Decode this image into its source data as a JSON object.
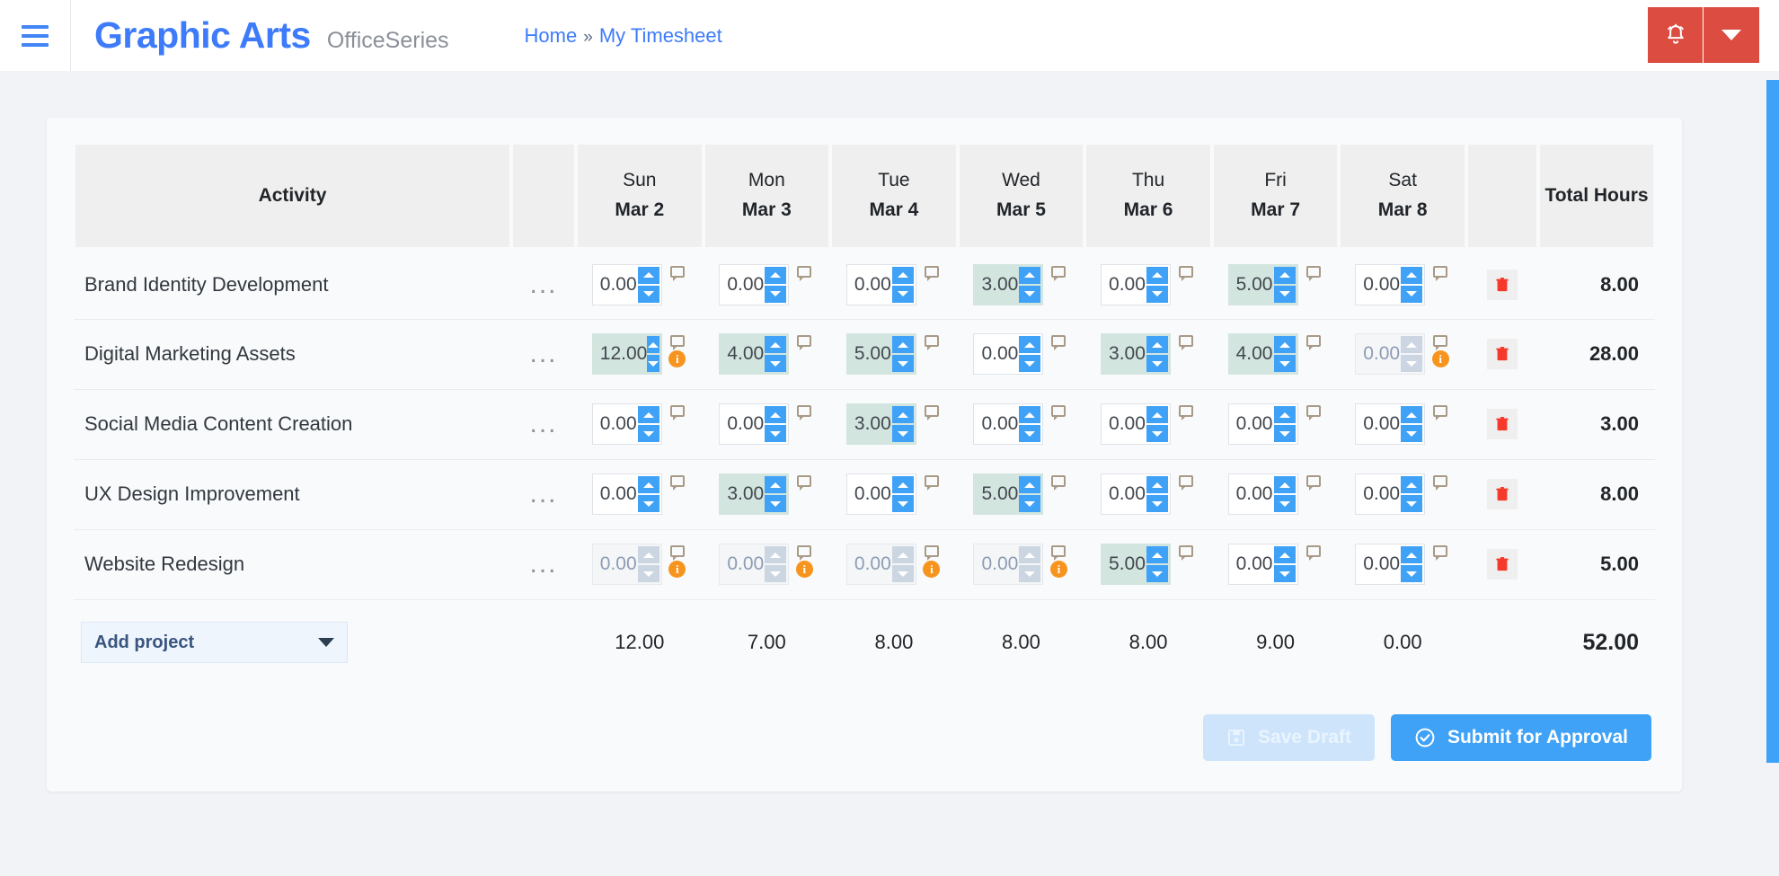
{
  "header": {
    "menu_icon": "hamburger-icon",
    "brand": "Graphic Arts",
    "brand_suffix": "OfficeSeries",
    "breadcrumb": {
      "home": "Home",
      "separator": "»",
      "current": "My Timesheet"
    },
    "notification_icon": "bell-icon",
    "notification_caret_icon": "chevron-down-icon",
    "notification_color": "#dc4c41",
    "brand_color": "#3d7bfb"
  },
  "table": {
    "columns": [
      {
        "label": "Activity"
      },
      {
        "dayname": "Sun",
        "daydate": "Mar 2"
      },
      {
        "dayname": "Mon",
        "daydate": "Mar 3"
      },
      {
        "dayname": "Tue",
        "daydate": "Mar 4"
      },
      {
        "dayname": "Wed",
        "daydate": "Mar 5"
      },
      {
        "dayname": "Thu",
        "daydate": "Mar 6"
      },
      {
        "dayname": "Fri",
        "daydate": "Mar 7"
      },
      {
        "dayname": "Sat",
        "daydate": "Mar 8"
      },
      {
        "label": "Total Hours"
      }
    ],
    "row_menu_icon": "ellipsis-icon",
    "comment_icon": "comment-icon",
    "info_icon": "info-icon",
    "delete_icon": "trash-icon",
    "rows": [
      {
        "activity": "Brand Identity Development",
        "cells": [
          {
            "value": "0.00",
            "filled": false,
            "disabled": false,
            "info": false
          },
          {
            "value": "0.00",
            "filled": false,
            "disabled": false,
            "info": false
          },
          {
            "value": "0.00",
            "filled": false,
            "disabled": false,
            "info": false
          },
          {
            "value": "3.00",
            "filled": true,
            "disabled": false,
            "info": false
          },
          {
            "value": "0.00",
            "filled": false,
            "disabled": false,
            "info": false
          },
          {
            "value": "5.00",
            "filled": true,
            "disabled": false,
            "info": false
          },
          {
            "value": "0.00",
            "filled": false,
            "disabled": false,
            "info": false
          }
        ],
        "total": "8.00"
      },
      {
        "activity": "Digital Marketing Assets",
        "cells": [
          {
            "value": "12.00",
            "filled": true,
            "disabled": false,
            "info": true
          },
          {
            "value": "4.00",
            "filled": true,
            "disabled": false,
            "info": false
          },
          {
            "value": "5.00",
            "filled": true,
            "disabled": false,
            "info": false
          },
          {
            "value": "0.00",
            "filled": false,
            "disabled": false,
            "info": false
          },
          {
            "value": "3.00",
            "filled": true,
            "disabled": false,
            "info": false
          },
          {
            "value": "4.00",
            "filled": true,
            "disabled": false,
            "info": false
          },
          {
            "value": "0.00",
            "filled": false,
            "disabled": true,
            "info": true
          }
        ],
        "total": "28.00"
      },
      {
        "activity": "Social Media Content Creation",
        "cells": [
          {
            "value": "0.00",
            "filled": false,
            "disabled": false,
            "info": false
          },
          {
            "value": "0.00",
            "filled": false,
            "disabled": false,
            "info": false
          },
          {
            "value": "3.00",
            "filled": true,
            "disabled": false,
            "info": false
          },
          {
            "value": "0.00",
            "filled": false,
            "disabled": false,
            "info": false
          },
          {
            "value": "0.00",
            "filled": false,
            "disabled": false,
            "info": false
          },
          {
            "value": "0.00",
            "filled": false,
            "disabled": false,
            "info": false
          },
          {
            "value": "0.00",
            "filled": false,
            "disabled": false,
            "info": false
          }
        ],
        "total": "3.00"
      },
      {
        "activity": "UX Design Improvement",
        "cells": [
          {
            "value": "0.00",
            "filled": false,
            "disabled": false,
            "info": false
          },
          {
            "value": "3.00",
            "filled": true,
            "disabled": false,
            "info": false
          },
          {
            "value": "0.00",
            "filled": false,
            "disabled": false,
            "info": false
          },
          {
            "value": "5.00",
            "filled": true,
            "disabled": false,
            "info": false
          },
          {
            "value": "0.00",
            "filled": false,
            "disabled": false,
            "info": false
          },
          {
            "value": "0.00",
            "filled": false,
            "disabled": false,
            "info": false
          },
          {
            "value": "0.00",
            "filled": false,
            "disabled": false,
            "info": false
          }
        ],
        "total": "8.00"
      },
      {
        "activity": "Website Redesign",
        "cells": [
          {
            "value": "0.00",
            "filled": false,
            "disabled": true,
            "info": true
          },
          {
            "value": "0.00",
            "filled": false,
            "disabled": true,
            "info": true
          },
          {
            "value": "0.00",
            "filled": false,
            "disabled": true,
            "info": true
          },
          {
            "value": "0.00",
            "filled": false,
            "disabled": true,
            "info": true
          },
          {
            "value": "5.00",
            "filled": true,
            "disabled": false,
            "info": false
          },
          {
            "value": "0.00",
            "filled": false,
            "disabled": false,
            "info": false
          },
          {
            "value": "0.00",
            "filled": false,
            "disabled": false,
            "info": false
          }
        ],
        "total": "5.00"
      }
    ],
    "footer": {
      "add_project_label": "Add project",
      "add_project_caret_icon": "chevron-down-icon",
      "day_totals": [
        "12.00",
        "7.00",
        "8.00",
        "8.00",
        "8.00",
        "9.00",
        "0.00"
      ],
      "grand_total": "52.00"
    }
  },
  "actions": {
    "save_draft": {
      "label": "Save Draft",
      "icon": "save-icon",
      "disabled": true
    },
    "submit": {
      "label": "Submit for Approval",
      "icon": "check-circle-icon",
      "disabled": false
    }
  },
  "colors": {
    "accent_blue": "#3fa2f7",
    "filled_cell": "#d3e5df",
    "info_orange": "#f7941e",
    "danger_red": "#dc4c41"
  }
}
